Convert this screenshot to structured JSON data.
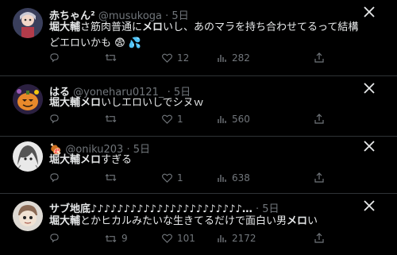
{
  "posts": [
    {
      "display_name": "赤ちゃん²",
      "handle": "@musukoga",
      "time": "5日",
      "text_highlight": "堀大輔",
      "text_mid": "さ筋肉普通に",
      "text_highlight2": "メロ",
      "text_rest": "いし、あのマラを持ち合わせてるって結構どエロいかも",
      "text_line2": "😨 💦",
      "replies": "",
      "reposts": "",
      "likes": "12",
      "views": "282",
      "avatar_icon": "anime-avatar-icon"
    },
    {
      "display_name": "はる",
      "handle": "@yoneharu0121_",
      "time": "5日",
      "text_highlight": "堀大輔",
      "text_highlight2": "メロ",
      "text_rest": "いしエロいしでシヌｗ",
      "replies": "",
      "reposts": "",
      "likes": "1",
      "views": "560",
      "avatar_icon": "pumpkin-avatar-icon"
    },
    {
      "display_name": "🍖",
      "handle": "@oniku203",
      "time": "5日",
      "text_highlight": "堀大輔",
      "text_highlight2": "メロ",
      "text_rest": "すぎる",
      "replies": "",
      "reposts": "",
      "likes": "1",
      "views": "638",
      "avatar_icon": "manga-avatar-icon"
    },
    {
      "display_name": "サブ地底♪♪♪♪♪♪♪♪♪♪♪♪♪♪♪♪♪♪♪♪♪♪♪…",
      "handle": "",
      "time": "5日",
      "text_highlight": "堀大輔",
      "text_mid": "とかヒカルみたいな生きてるだけで面白い男",
      "text_highlight2": "メロ",
      "text_rest": "い",
      "replies": "",
      "reposts": "9",
      "likes": "101",
      "views": "2172",
      "avatar_icon": "doll-avatar-icon"
    }
  ]
}
